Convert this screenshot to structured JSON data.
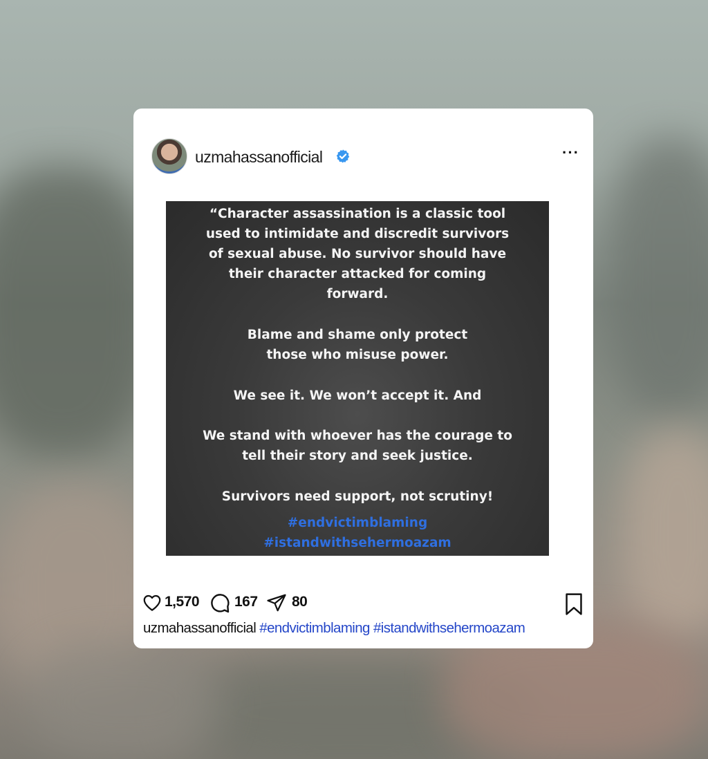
{
  "post": {
    "username": "uzmahassanofficial",
    "verified_icon": "verified-badge-icon",
    "more_label": "···",
    "image_text": {
      "p1": [
        "“Character assassination is a classic tool",
        "used to intimidate and discredit survivors",
        "of sexual abuse. No survivor should have",
        "their character attacked for coming",
        "forward."
      ],
      "p2": [
        "Blame and shame only protect",
        "those who misuse power."
      ],
      "p3": [
        "We see it. We won’t accept it. And"
      ],
      "p4": [
        "We stand with whoever has the courage to",
        "tell their story and seek justice."
      ],
      "p5": [
        "Survivors need support, not scrutiny!"
      ],
      "hashtags": [
        "#endvictimblaming",
        "#istandwithsehermoazam"
      ]
    },
    "likes": "1,570",
    "comments": "167",
    "shares": "80",
    "caption": {
      "username": "uzmahassanofficial",
      "tag1": "#endvictimblaming",
      "tag2": "#istandwithsehermoazam"
    }
  },
  "colors": {
    "hashtag_image": "#2f6fe0",
    "hashtag_caption": "#2446c8",
    "verified": "#3897f0"
  }
}
